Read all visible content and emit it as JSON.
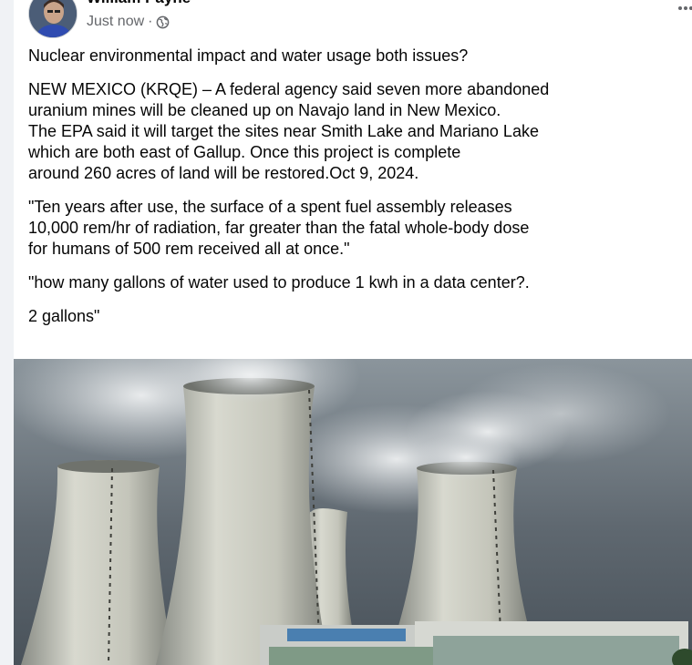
{
  "post": {
    "author": "William Payne",
    "timestamp": "Just now",
    "separator": "·",
    "audience_icon": "globe-icon",
    "more_icon": "more-options-icon",
    "paragraphs": [
      "Nuclear environmental impact and water usage both issues?",
      "NEW MEXICO (KRQE) – A federal agency said seven more abandoned\nuranium mines will be cleaned up on Navajo land in New Mexico.\nThe EPA said it will target the sites near Smith Lake and Mariano Lake\nwhich are both east of Gallup. Once this project is complete\naround 260 acres of land will be restored.Oct 9, 2024.",
      "\"Ten years after use, the surface of a spent fuel assembly releases\n10,000 rem/hr of radiation, far greater than the fatal whole-body dose\nfor humans of 500 rem received all at once.\"",
      "\"how many gallons of water used to produce 1 kwh in a data center?.",
      "2 gallons\""
    ],
    "image_subject": "nuclear cooling towers with steam"
  },
  "colors": {
    "text_primary": "#050505",
    "text_secondary": "#65676b",
    "card_bg": "#ffffff",
    "page_bg": "#f0f2f5"
  }
}
